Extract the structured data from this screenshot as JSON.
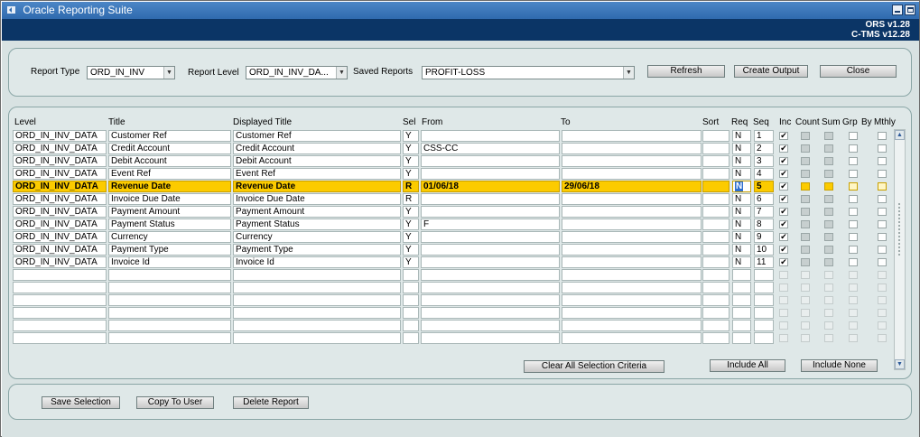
{
  "window": {
    "title": "Oracle Reporting Suite",
    "ors_version": "ORS v1.28",
    "ctms_version": "C-TMS v12.28"
  },
  "controls": {
    "report_type_label": "Report Type",
    "report_type_value": "ORD_IN_INV",
    "report_level_label": "Report Level",
    "report_level_value": "ORD_IN_INV_DA...",
    "saved_reports_label": "Saved Reports",
    "saved_reports_value": "PROFIT-LOSS",
    "refresh": "Refresh",
    "create_output": "Create Output",
    "close": "Close"
  },
  "grid": {
    "headers": {
      "level": "Level",
      "title": "Title",
      "displayed_title": "Displayed Title",
      "sel": "Sel",
      "from": "From",
      "to": "To",
      "sort": "Sort",
      "req": "Req",
      "seq": "Seq",
      "inc": "Inc",
      "count": "Count",
      "sum": "Sum",
      "grp": "Grp",
      "by": "By",
      "mthly": "Mthly"
    },
    "rows": [
      {
        "level": "ORD_IN_INV_DATA",
        "title": "Customer Ref",
        "displayed": "Customer Ref",
        "sel": "Y",
        "from": "",
        "to": "",
        "sort": "",
        "req": "N",
        "seq": "1",
        "inc": true
      },
      {
        "level": "ORD_IN_INV_DATA",
        "title": "Credit Account",
        "displayed": "Credit Account",
        "sel": "Y",
        "from": "CSS-CC",
        "to": "",
        "sort": "",
        "req": "N",
        "seq": "2",
        "inc": true
      },
      {
        "level": "ORD_IN_INV_DATA",
        "title": "Debit Account",
        "displayed": "Debit Account",
        "sel": "Y",
        "from": "",
        "to": "",
        "sort": "",
        "req": "N",
        "seq": "3",
        "inc": true
      },
      {
        "level": "ORD_IN_INV_DATA",
        "title": "Event Ref",
        "displayed": "Event Ref",
        "sel": "Y",
        "from": "",
        "to": "",
        "sort": "",
        "req": "N",
        "seq": "4",
        "inc": true
      },
      {
        "level": "ORD_IN_INV_DATA",
        "title": "Revenue Date",
        "displayed": "Revenue Date",
        "sel": "R",
        "from": "01/06/18",
        "to": "29/06/18",
        "sort": "",
        "req": "N",
        "seq": "5",
        "inc": true,
        "highlight": true
      },
      {
        "level": "ORD_IN_INV_DATA",
        "title": "Invoice Due Date",
        "displayed": "Invoice Due Date",
        "sel": "R",
        "from": "",
        "to": "",
        "sort": "",
        "req": "N",
        "seq": "6",
        "inc": true
      },
      {
        "level": "ORD_IN_INV_DATA",
        "title": "Payment Amount",
        "displayed": "Payment Amount",
        "sel": "Y",
        "from": "",
        "to": "",
        "sort": "",
        "req": "N",
        "seq": "7",
        "inc": true
      },
      {
        "level": "ORD_IN_INV_DATA",
        "title": "Payment Status",
        "displayed": "Payment Status",
        "sel": "Y",
        "from": "F",
        "to": "",
        "sort": "",
        "req": "N",
        "seq": "8",
        "inc": true
      },
      {
        "level": "ORD_IN_INV_DATA",
        "title": "Currency",
        "displayed": "Currency",
        "sel": "Y",
        "from": "",
        "to": "",
        "sort": "",
        "req": "N",
        "seq": "9",
        "inc": true
      },
      {
        "level": "ORD_IN_INV_DATA",
        "title": "Payment Type",
        "displayed": "Payment Type",
        "sel": "Y",
        "from": "",
        "to": "",
        "sort": "",
        "req": "N",
        "seq": "10",
        "inc": true
      },
      {
        "level": "ORD_IN_INV_DATA",
        "title": "Invoice Id",
        "displayed": "Invoice Id",
        "sel": "Y",
        "from": "",
        "to": "",
        "sort": "",
        "req": "N",
        "seq": "11",
        "inc": true
      }
    ],
    "empty_rows": 6,
    "clear_all": "Clear All Selection Criteria",
    "include_all": "Include All",
    "include_none": "Include None"
  },
  "footer": {
    "save_selection": "Save Selection",
    "copy_to_user": "Copy To User",
    "delete_report": "Delete Report"
  },
  "colors": {
    "title_bar": "#3a76ba",
    "version_bar": "#0b3566",
    "panel_bg": "#dfe8e8",
    "highlight_row": "#fccb00"
  },
  "icons": {
    "app": "app-icon",
    "minimize": "minimize-icon",
    "maximize": "maximize-icon",
    "dropdown": "chevron-down-icon",
    "check": "check-icon",
    "scroll_up": "scroll-up-icon",
    "scroll_down": "scroll-down-icon"
  }
}
